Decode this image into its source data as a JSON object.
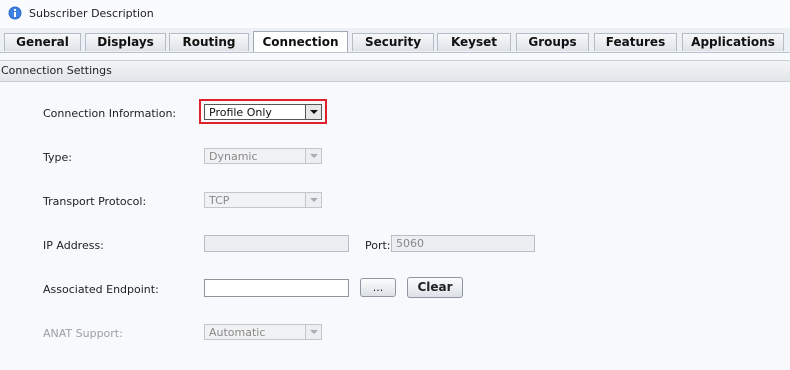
{
  "window": {
    "title": "Subscriber Description",
    "title_icon": "info-icon"
  },
  "tabs": [
    {
      "label": "General",
      "active": false
    },
    {
      "label": "Displays",
      "active": false
    },
    {
      "label": "Routing",
      "active": false
    },
    {
      "label": "Connection",
      "active": true
    },
    {
      "label": "Security",
      "active": false
    },
    {
      "label": "Keyset",
      "active": false
    },
    {
      "label": "Groups",
      "active": false
    },
    {
      "label": "Features",
      "active": false
    },
    {
      "label": "Applications",
      "active": false
    }
  ],
  "section": {
    "title": "Connection Settings"
  },
  "form": {
    "connection_info": {
      "label": "Connection Information:",
      "value": "Profile Only"
    },
    "type": {
      "label": "Type:",
      "value": "Dynamic"
    },
    "transport": {
      "label": "Transport Protocol:",
      "value": "TCP"
    },
    "ip": {
      "label": "IP Address:",
      "value": ""
    },
    "port": {
      "label": "Port:",
      "value": "5060"
    },
    "endpoint": {
      "label": "Associated Endpoint:",
      "value": "",
      "browse_label": "...",
      "clear_label": "Clear"
    },
    "anat": {
      "label": "ANAT Support:",
      "value": "Automatic"
    }
  },
  "colors": {
    "highlight": "#e0202a",
    "info_icon": "#2f6fcf"
  }
}
